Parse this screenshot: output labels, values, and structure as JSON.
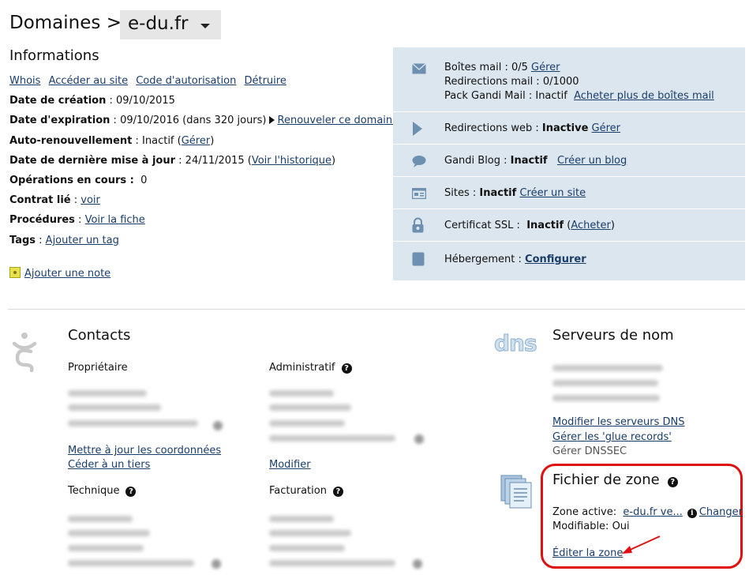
{
  "header": {
    "breadcrumb": "Domaines >",
    "domain": "e-du.fr"
  },
  "info": {
    "title": "Informations",
    "links": [
      "Whois",
      "Accéder au site",
      "Code d'autorisation",
      "Détruire"
    ],
    "creation_label": "Date de création",
    "creation_value": " : 09/10/2015",
    "expiration_label": "Date d'expiration",
    "expiration_value": " : 09/10/2016 (dans 320 jours)",
    "renew_link": "Renouveler ce domaine",
    "autorenew_label": "Auto-renouvellement",
    "autorenew_value": " : Inactif (",
    "autorenew_link": "Gérer",
    "autorenew_close": ")",
    "lastupdate_label": "Date de dernière mise à jour",
    "lastupdate_value": " : 24/11/2015 (",
    "history_link": "Voir l'historique",
    "history_close": ")",
    "ops_label": "Opérations en cours :",
    "ops_value": "0",
    "contract_label": "Contrat lié",
    "contract_sep": " : ",
    "contract_link": "voir",
    "procedures_label": "Procédures",
    "procedures_sep": " : ",
    "procedures_link": "Voir la fiche",
    "tags_label": "Tags",
    "tags_sep": " : ",
    "tags_link": "Ajouter un tag",
    "note_link": "Ajouter une note"
  },
  "services": {
    "mail_line1": "Boîtes mail : 0/5 ",
    "mail_manage": "Gérer",
    "mail_line2": "Redirections mail : 0/1000",
    "mail_line3": "Pack Gandi Mail : Inactif",
    "mail_buy": "Acheter plus de boîtes mail",
    "web_label": "Redirections web : ",
    "web_status": "Inactive",
    "web_manage": "Gérer",
    "blog_label": "Gandi Blog : ",
    "blog_status": "Inactif",
    "blog_create": "Créer un blog",
    "sites_label": "Sites : ",
    "sites_status": "Inactif",
    "sites_create": "Créer un site",
    "ssl_label": "Certificat SSL : ",
    "ssl_status": "Inactif",
    "ssl_open": " (",
    "ssl_buy": "Acheter",
    "ssl_close": ")",
    "hosting_label": "Hébergement : ",
    "hosting_configure": "Configurer"
  },
  "contacts": {
    "title": "Contacts",
    "owner": "Propriétaire",
    "admin": "Administratif",
    "tech": "Technique",
    "billing": "Facturation",
    "update_link": "Mettre à jour les coordonnées",
    "transfer_link": "Céder à un tiers",
    "modify_link": "Modifier",
    "help_glyph": "?"
  },
  "nameservers": {
    "logo": "dns",
    "title": "Serveurs de nom",
    "modify_link": "Modifier les serveurs DNS",
    "glue_link": "Gérer les 'glue records'",
    "dnssec": "Gérer DNSSEC"
  },
  "zone": {
    "title": "Fichier de zone",
    "active_label": "Zone active:",
    "active_value": "e-du.fr ve...",
    "info_glyph": "i",
    "change_link": "Changer",
    "modifiable": "Modifiable: Oui",
    "edit_link": "Éditer la zone"
  },
  "colors": {
    "panel": "#dbe6ee",
    "highlight": "#e01010",
    "link": "#1a3d6b",
    "icon": "#6d8fb0"
  }
}
